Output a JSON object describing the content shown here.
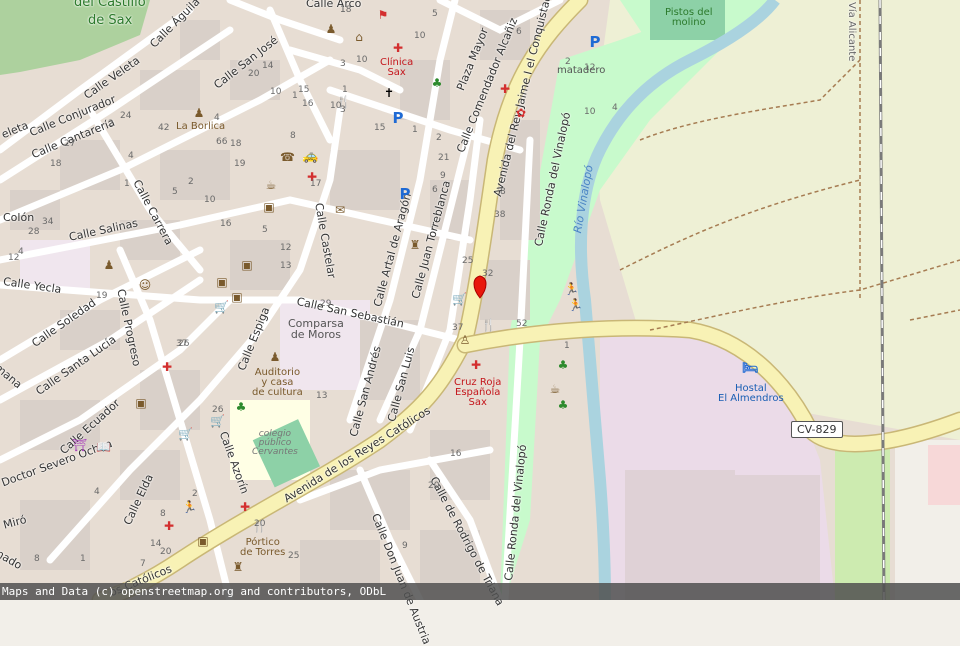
{
  "streets": {
    "castillo_1": "del Castillo",
    "castillo_2": "de Sax",
    "arco": "Calle Arco",
    "aguila": "Calle Águila",
    "veleta": "Calle Veleta",
    "veleta2": "Veleta",
    "san_jose": "Calle San José",
    "conjurador": "Calle Conjurador",
    "cantareria": "Calle Cantarería",
    "plaza_mayor": "Plaza Mayor",
    "comendador": "Calle Comendador Alcañiz",
    "rey_jaime": "Avenida del Rey Jaime I el Conquistador",
    "carrera": "Calle Carrera",
    "colon": "Colón",
    "salinas": "Calle Salinas",
    "castelar": "Calle Castelar",
    "artal": "Calle Artal de Aragón",
    "torreblanca": "Calle Juan Torreblanca",
    "ronda_1": "Calle Ronda del Vinalopó",
    "ronda_2": "Calle Ronda del Vinalopó",
    "yecla": "Calle Yecla",
    "progreso": "Calle Progreso",
    "soledad": "Calle Soledad",
    "santa_lucia": "Calle Santa Lucía",
    "espiga": "Calle Espiga",
    "san_sebastian": "Calle San Sebastián",
    "san_andres": "Calle San Andrés",
    "san_luis": "Calle San Luis",
    "ecuador": "Calle Ecuador",
    "severo": "Doctor Severo Ochoa",
    "azorin": "Calle Azorín",
    "reyes_catolicos": "Avenida de los Reyes Católicos",
    "reyes_catolicos_2": "os Católicos",
    "elda": "Calle Elda",
    "miro": "Miró",
    "rodrigo": "Calle de Rodrigo de Triana",
    "don_juan": "Calle Don Juan de Austria",
    "mama": "mana",
    "nado": "nado",
    "eleta": "eleta",
    "alicante": "Vía Alicante",
    "river": "Río Vinalopó"
  },
  "pois": {
    "clinica": [
      "Clínica",
      "Sax"
    ],
    "borlica": "La Borlica",
    "matadero": "matadero",
    "pistos": [
      "Pistos del",
      "molino"
    ],
    "comparsa": [
      "Comparsa",
      "de Moros"
    ],
    "auditorio": [
      "Auditorio",
      "y casa",
      "de cultura"
    ],
    "colegio": [
      "colegio",
      "público",
      "Cervantes"
    ],
    "cruz_roja": [
      "Cruz Roja",
      "Española",
      "Sax"
    ],
    "hostal": [
      "Hostal",
      "El Almendros"
    ],
    "portico": [
      "Pórtico",
      "de Torres"
    ]
  },
  "road_ref": "CV-829",
  "house_numbers": [
    "1",
    "3",
    "10",
    "12",
    "10",
    "4",
    "2",
    "5",
    "6",
    "8",
    "18",
    "20",
    "42",
    "4",
    "2",
    "24",
    "28",
    "12",
    "19",
    "26",
    "34",
    "27",
    "1",
    "3",
    "8",
    "25",
    "32",
    "37",
    "38",
    "29",
    "21",
    "13",
    "20",
    "9",
    "16",
    "17",
    "19",
    "16",
    "20",
    "1",
    "8",
    "66",
    "4",
    "37",
    "26",
    "2",
    "25",
    "52",
    "1",
    "10",
    "10",
    "15",
    "1",
    "2",
    "9",
    "13",
    "5",
    "12",
    "6",
    "15",
    "14",
    "16",
    "1",
    "4",
    "18",
    "1",
    "5",
    "10",
    "14",
    "7",
    "20",
    "2",
    "4",
    "8",
    "10",
    "18"
  ],
  "icon_names": {
    "pharmacy": "pharmacy-icon",
    "parking": "parking-icon",
    "church": "place-of-worship-icon",
    "theatre": "theatre-icon",
    "playground": "playground-icon",
    "marker": "location-marker-icon"
  },
  "attribution": "Maps and Data (c) openstreetmap.org and contributors, ODbL",
  "colors": {
    "land": "#f2efe9",
    "buildings": "#d9d0c9",
    "primary_road": "#f8f2b5",
    "primary_casing": "#c9b776",
    "park": "#cdebb0",
    "water": "#aad3df",
    "school": "#ffffe5",
    "farmland": "#eef0d5",
    "industrial": "#ebdbe8",
    "pharmacy": "#d32f2f",
    "parking": "#1f6ad4",
    "marker": "#e8180c"
  }
}
